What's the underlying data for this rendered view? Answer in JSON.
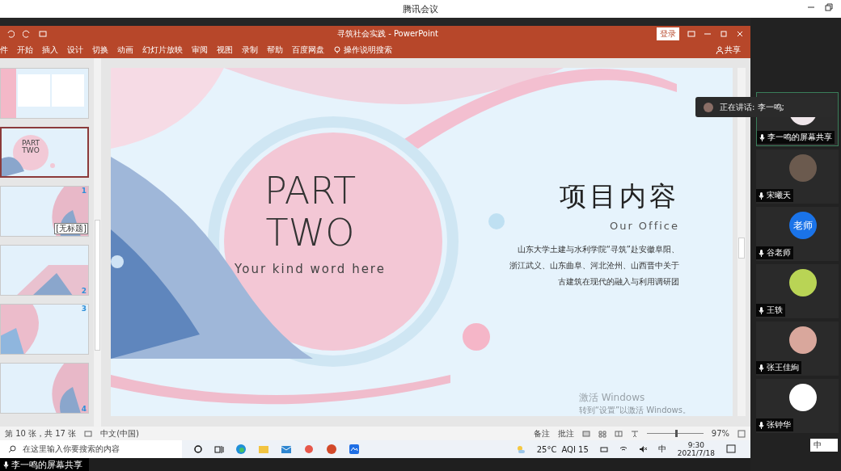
{
  "meeting_window": {
    "title": "腾讯会议"
  },
  "ppt": {
    "title": "寻筑社会实践 - PowerPoint",
    "login": "登录",
    "ribbon_tabs": [
      "件",
      "开始",
      "插入",
      "设计",
      "切换",
      "动画",
      "幻灯片放映",
      "审阅",
      "视图",
      "录制",
      "帮助",
      "百度网盘"
    ],
    "search_hint": "操作说明搜索",
    "share": "共享"
  },
  "thumbnails": [
    {
      "kind": "table",
      "selected": false
    },
    {
      "kind": "title",
      "selected": true,
      "heading": "PART TWO"
    },
    {
      "kind": "arc",
      "selected": false,
      "number": "1",
      "tooltip": "[无标题]"
    },
    {
      "kind": "wedge",
      "selected": false,
      "number": "2"
    },
    {
      "kind": "circle",
      "selected": false,
      "number": "3"
    },
    {
      "kind": "arc",
      "selected": false,
      "number": "4"
    }
  ],
  "slide": {
    "part": "PART",
    "two": "TWO",
    "tagline": "Your kind word here",
    "title": "项目内容",
    "subtitle": "Our Office",
    "body_lines": [
      "山东大学土建与水利学院“寻筑”赴安徽阜阳、",
      "浙江武义、山东曲阜、河北沧州、山西晋中关于",
      "古建筑在现代的融入与利用调研团"
    ]
  },
  "activation": {
    "title": "激活 Windows",
    "hint": "转到“设置”以激活 Windows。"
  },
  "status_bar": {
    "slide_count": "第 10 张，共 17 张",
    "language": "中文(中国)",
    "notes": "备注",
    "comments": "批注",
    "zoom": "97%",
    "level": 0.5
  },
  "taskbar": {
    "search_placeholder": "在这里输入你要搜索的内容",
    "weather": "25°C",
    "aqi": "AQI 15",
    "ime": "中",
    "time": "9:30",
    "date": "2021/7/18"
  },
  "share_label": "李一鸣的屏幕共享",
  "speaking": "正在讲话: 李一鸣;",
  "participants": [
    {
      "name": "李一鸣的屏幕共享",
      "kind": "share",
      "color": "#efe6ea"
    },
    {
      "name": "宋曦天",
      "kind": "photo",
      "color": "#6b5a4e"
    },
    {
      "name": "谷老师",
      "kind": "initials",
      "avatar_text": "老师",
      "color": "#1a73e8"
    },
    {
      "name": "王轶",
      "kind": "photo",
      "color": "#b9d455"
    },
    {
      "name": "张王佳絢",
      "kind": "photo",
      "color": "#d9a79c"
    },
    {
      "name": "张钟华",
      "kind": "photo",
      "color": "#ffffff"
    }
  ],
  "ime_bar": "中"
}
